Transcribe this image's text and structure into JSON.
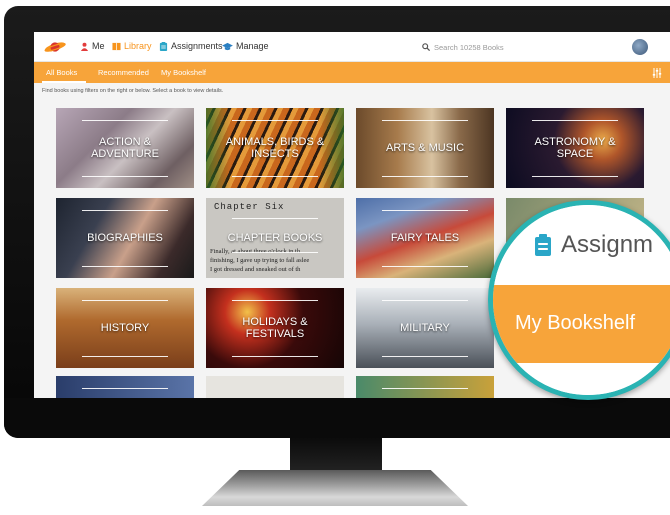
{
  "colors": {
    "accent": "#f7941d",
    "subnav": "#f7a43a",
    "assignments_icon": "#2aa6c8",
    "manage_icon": "#2a7fc2",
    "me_icon": "#e23c3c",
    "magnifier_ring": "#2ab3b3"
  },
  "topbar": {
    "nav": [
      {
        "label": "Me",
        "icon": "person-icon"
      },
      {
        "label": "Library",
        "icon": "book-icon"
      },
      {
        "label": "Assignments",
        "icon": "clipboard-icon"
      },
      {
        "label": "Manage",
        "icon": "graduation-cap-icon"
      }
    ],
    "search_placeholder": "Search 10258 Books"
  },
  "subnav": {
    "tabs": [
      "All Books",
      "Recommended",
      "My Bookshelf"
    ],
    "active": "All Books"
  },
  "hint": "Find books using filters on the right or below. Select a book to view details.",
  "categories": [
    {
      "label": "ACTION & ADVENTURE"
    },
    {
      "label": "ANIMALS, BIRDS & INSECTS"
    },
    {
      "label": "ARTS & MUSIC"
    },
    {
      "label": "ASTRONOMY & SPACE"
    },
    {
      "label": "BIOGRAPHIES"
    },
    {
      "label": "CHAPTER BOOKS"
    },
    {
      "label": "FAIRY TALES"
    },
    {
      "label": "HISTORY"
    },
    {
      "label": "HOLIDAYS & FESTIVALS"
    },
    {
      "label": "MILITARY"
    }
  ],
  "chapter_book_text": {
    "heading": "Chapter Six",
    "line1": "Finally, at about three o'clock in th",
    "line2": "finishing, I gave up trying to fall aslee",
    "line3": "I got dressed and sneaked out of th"
  },
  "magnifier": {
    "assign_text": "Assignm",
    "bookshelf_text": "My Bookshelf"
  }
}
